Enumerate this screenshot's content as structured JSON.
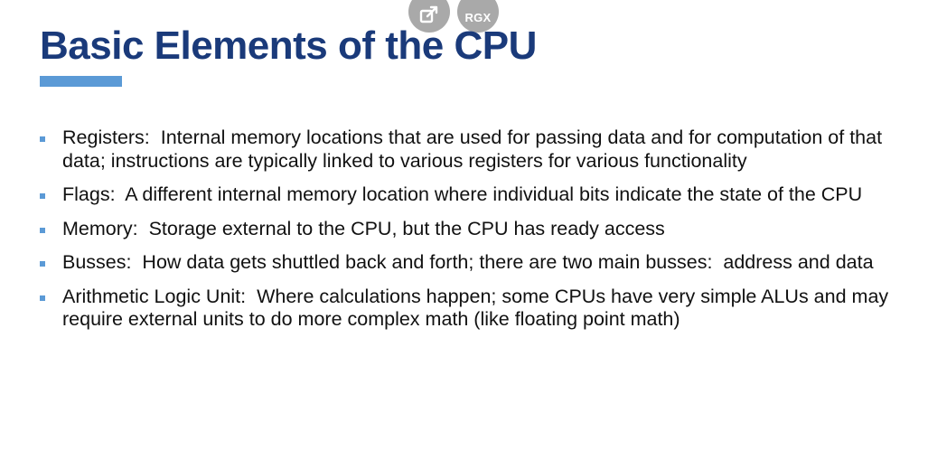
{
  "slide": {
    "title": "Basic Elements of the CPU",
    "accent_color": "#5b9ad6",
    "title_color": "#1a3a7a"
  },
  "controls": [
    {
      "icon": "popout-icon",
      "label": ""
    },
    {
      "icon": "rgx-icon",
      "label": "RGX"
    }
  ],
  "bullets": [
    {
      "text": "Registers:  Internal memory locations that are used for passing data and for computation of that data; instructions are typically linked to various registers for various functionality"
    },
    {
      "text": "Flags:  A different internal memory location where individual bits indicate the state of the CPU"
    },
    {
      "text": "Memory:  Storage external to the CPU, but the CPU has ready access"
    },
    {
      "text": "Busses:  How data gets shuttled back and forth; there are two main busses:  address and data"
    },
    {
      "text": "Arithmetic Logic Unit:  Where calculations happen; some CPUs have very simple ALUs and may require external units to do more complex math (like floating point math)"
    }
  ]
}
